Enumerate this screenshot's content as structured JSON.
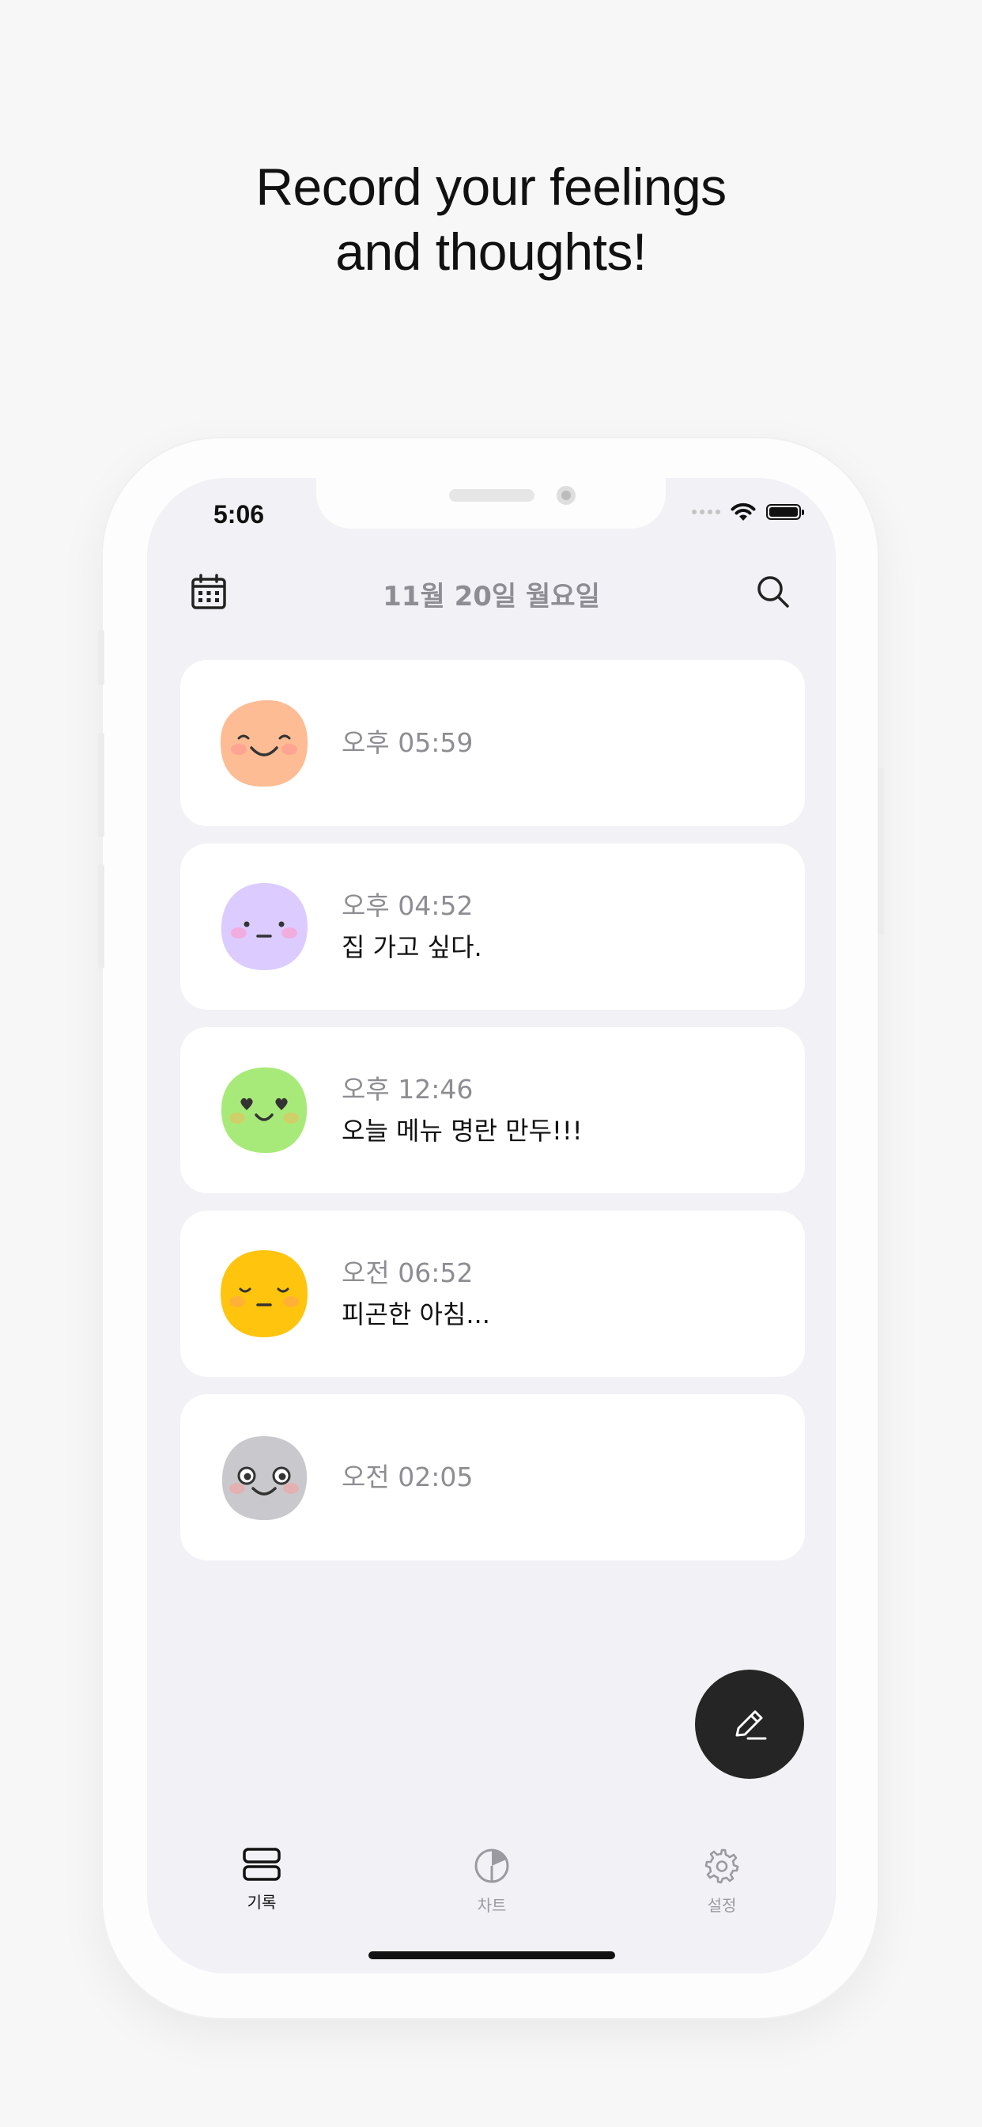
{
  "headline": {
    "line1": "Record your feelings",
    "line2": "and thoughts!"
  },
  "status_bar": {
    "time": "5:06"
  },
  "header": {
    "date_title": "11월 20일 월요일",
    "calendar_icon": "calendar-icon",
    "search_icon": "search-icon"
  },
  "entries": [
    {
      "time": "오후 05:59",
      "memo": "",
      "mood": "happy",
      "color": "#fdbc94"
    },
    {
      "time": "오후 04:52",
      "memo": "집 가고 싶다.",
      "mood": "neutral",
      "color": "#dccbff"
    },
    {
      "time": "오후 12:46",
      "memo": "오늘 메뉴 명란 만두!!!",
      "mood": "love",
      "color": "#a8ea79"
    },
    {
      "time": "오전 06:52",
      "memo": "피곤한 아침...",
      "mood": "tired",
      "color": "#ffc40e"
    },
    {
      "time": "오전 02:05",
      "memo": "",
      "mood": "dizzy",
      "color": "#c9c9cd"
    }
  ],
  "fab": {
    "icon": "pencil-icon"
  },
  "tabs": [
    {
      "label": "기록",
      "icon": "records-icon",
      "active": true
    },
    {
      "label": "차트",
      "icon": "chart-icon",
      "active": false
    },
    {
      "label": "설정",
      "icon": "gear-icon",
      "active": false
    }
  ],
  "colors": {
    "background": "#f7f7f7",
    "screen": "#f1f1f6",
    "card": "#ffffff",
    "muted_text": "#8d8d93",
    "fab": "#252525"
  }
}
